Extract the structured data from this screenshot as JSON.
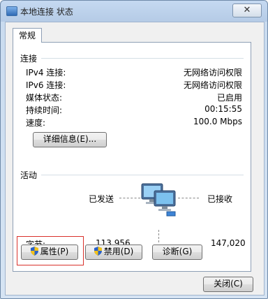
{
  "window": {
    "title": "本地连接 状态",
    "close_glyph": "✕"
  },
  "tabs": [
    {
      "label": "常规"
    }
  ],
  "connection": {
    "heading": "连接",
    "rows": [
      {
        "label": "IPv4 连接:",
        "value": "无网络访问权限"
      },
      {
        "label": "IPv6 连接:",
        "value": "无网络访问权限"
      },
      {
        "label": "媒体状态:",
        "value": "已启用"
      },
      {
        "label": "持续时间:",
        "value": "00:15:55"
      },
      {
        "label": "速度:",
        "value": "100.0 Mbps"
      }
    ],
    "details_button": "详细信息(E)..."
  },
  "activity": {
    "heading": "活动",
    "sent_label": "已发送",
    "received_label": "已接收",
    "bytes_label": "字节:",
    "bytes_sent": "113,956",
    "bytes_received": "147,020"
  },
  "buttons": {
    "properties": "属性(P)",
    "disable": "禁用(D)",
    "diagnose": "诊断(G)",
    "close": "关闭(C)"
  },
  "colors": {
    "highlight_box": "#d9312b",
    "shield_blue": "#2b62c9",
    "shield_yellow": "#f3c21b"
  }
}
